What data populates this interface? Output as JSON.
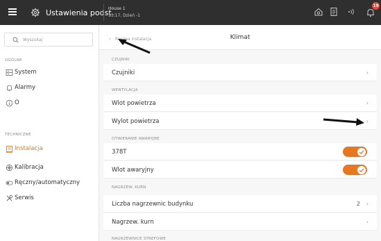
{
  "topbar": {
    "title": "Ustawienia podst",
    "house_name": "House 1",
    "house_date": "13:17, Dzień -1",
    "notification_count": "19"
  },
  "sidebar": {
    "search_placeholder": "Wyszukaj",
    "sections": [
      {
        "header": "OGÓLNE",
        "items": [
          {
            "label": "System",
            "icon": "server-icon"
          },
          {
            "label": "Alarmy",
            "icon": "bell-icon"
          },
          {
            "label": "O",
            "icon": "info-icon"
          }
        ]
      },
      {
        "header": "TECHNICZNE",
        "items": [
          {
            "label": "Instalacja",
            "icon": "installation-icon",
            "active": true
          },
          {
            "label": "Kalibracja",
            "icon": "calibration-icon"
          },
          {
            "label": "Ręczny/automatyczny",
            "icon": "manual-auto-icon"
          },
          {
            "label": "Serwis",
            "icon": "wrench-icon"
          }
        ]
      }
    ]
  },
  "main": {
    "back_label": "Ręczna instalacja",
    "title": "Klimat",
    "groups": [
      {
        "header": "CZUJNIKI",
        "rows": [
          {
            "label": "Czujniki",
            "type": "nav"
          }
        ]
      },
      {
        "header": "WENTYLACJA",
        "rows": [
          {
            "label": "Wlot powietrza",
            "type": "nav"
          },
          {
            "label": "Wylot powietrza",
            "type": "nav"
          }
        ]
      },
      {
        "header": "OTWIERANIE AWARYJNE",
        "rows": [
          {
            "label": "378T",
            "type": "toggle",
            "on": true
          },
          {
            "label": "Wlot awaryjny",
            "type": "toggle",
            "on": true
          }
        ]
      },
      {
        "header": "NAGRZEW. KURN",
        "rows": [
          {
            "label": "Liczba nagrzewnic budynku",
            "type": "value",
            "value": "2"
          },
          {
            "label": "Nagrzew. kurn",
            "type": "nav"
          }
        ]
      },
      {
        "header": "NAGRZEWNICE STREFOWE",
        "rows": []
      }
    ]
  },
  "colors": {
    "accent": "#e87722",
    "topbar_bg": "#2f2f2f",
    "badge": "#e8463a"
  }
}
